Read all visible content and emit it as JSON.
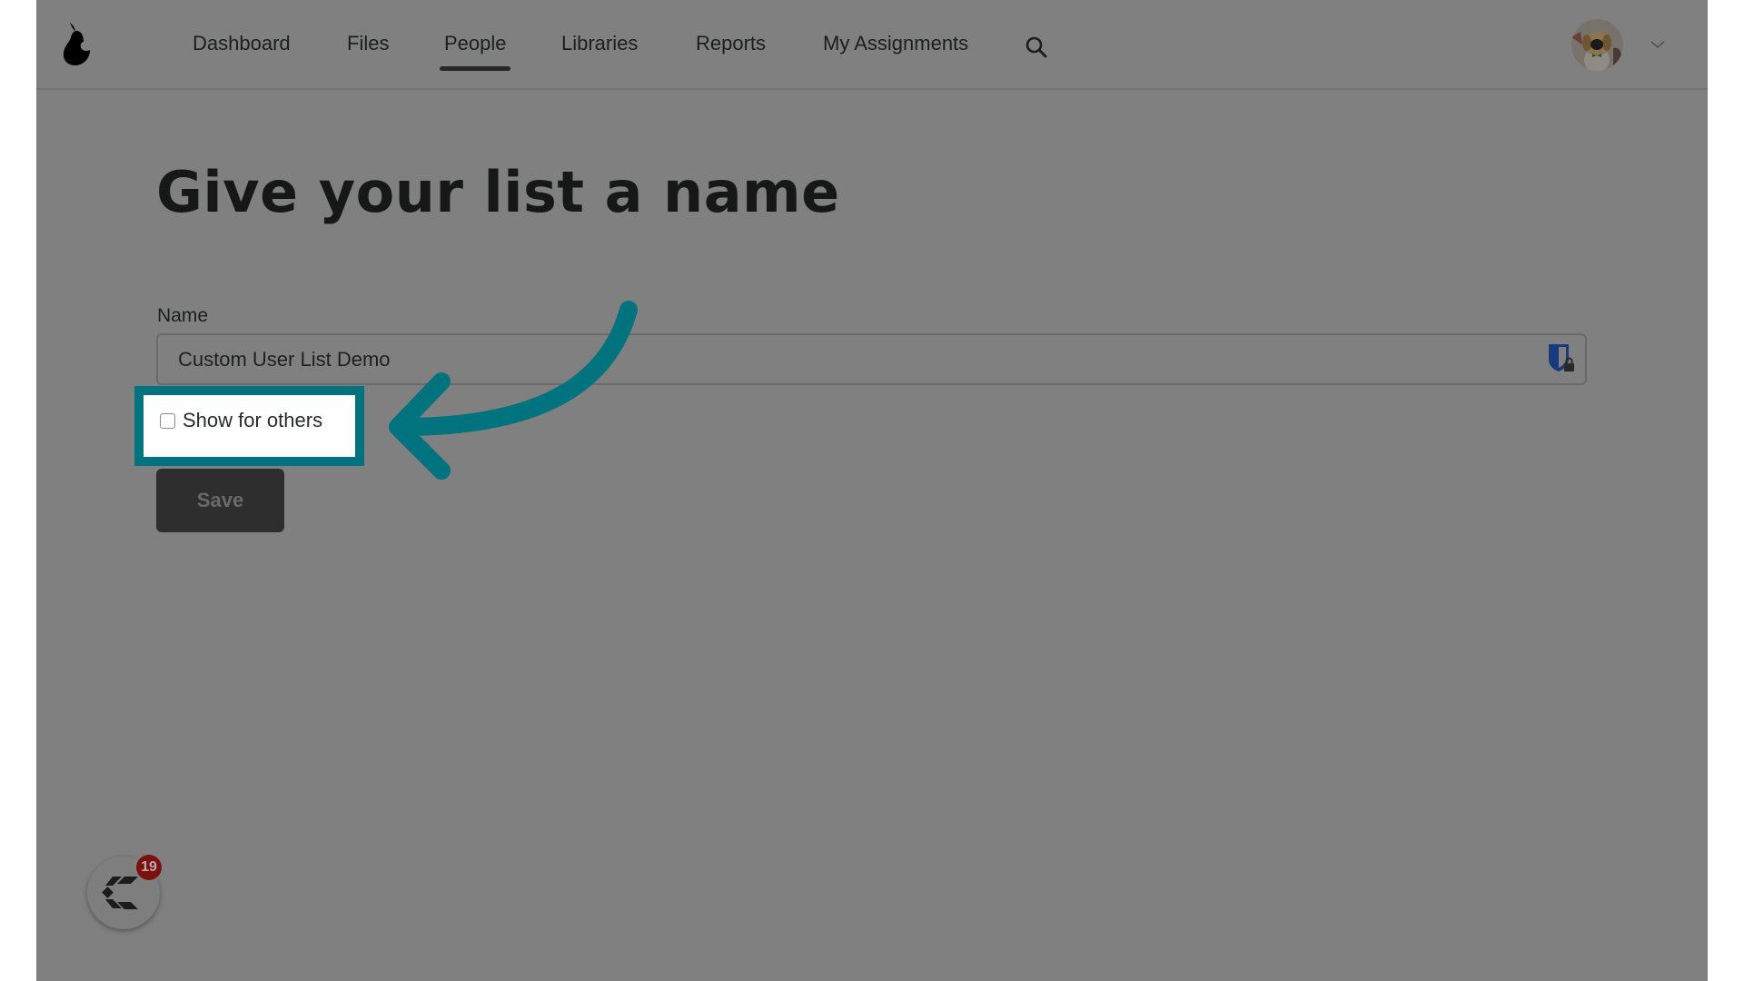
{
  "header": {
    "logo": "pear-logo-icon",
    "nav": [
      {
        "label": "Dashboard",
        "active": false
      },
      {
        "label": "Files",
        "active": false
      },
      {
        "label": "People",
        "active": true
      },
      {
        "label": "Libraries",
        "active": false
      },
      {
        "label": "Reports",
        "active": false
      },
      {
        "label": "My Assignments",
        "active": false
      }
    ],
    "search_icon": "search-icon",
    "avatar_icon": "user-avatar-dog",
    "menu_icon": "chevron-down-icon"
  },
  "main": {
    "title": "Give your list a name",
    "name_field": {
      "label": "Name",
      "value": "Custom User List Demo",
      "password_manager_icon": "bitwarden-shield-lock-icon"
    },
    "show_for_others": {
      "label": "Show for others",
      "checked": false
    },
    "save_label": "Save"
  },
  "annotation": {
    "highlight_color": "#00737e",
    "arrow_icon": "curved-arrow-left-icon"
  },
  "launcher": {
    "icon": "launcher-c-icon",
    "badge_count": "19"
  },
  "colors": {
    "overlay_gray": "#808080",
    "accent_teal": "#00737e",
    "badge_red": "#7a1010"
  }
}
